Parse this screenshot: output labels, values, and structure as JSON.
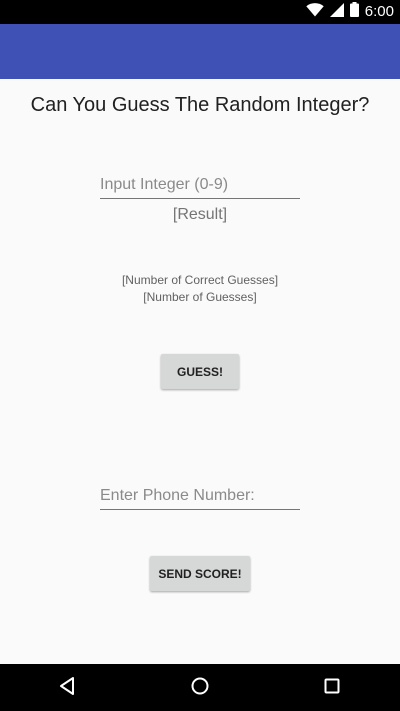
{
  "status_bar": {
    "time": "6:00",
    "icons": [
      "wifi-icon",
      "signal-icon",
      "battery-icon"
    ]
  },
  "colors": {
    "app_bar": "#3f51b5",
    "status_bar": "#000000",
    "background": "#fafafa",
    "button": "#d6d7d7"
  },
  "main": {
    "title": "Can You Guess The Random Integer?",
    "guess_input": {
      "value": "",
      "placeholder": "Input Integer (0-9)"
    },
    "result": "[Result]",
    "correct_guesses": "[Number of Correct Guesses]",
    "total_guesses": "[Number of Guesses]",
    "guess_button": "GUESS!",
    "phone_input": {
      "value": "",
      "placeholder": "Enter Phone Number:"
    },
    "send_button": "SEND SCORE!"
  },
  "nav_bar": {
    "icons": [
      "back-icon",
      "home-icon",
      "recents-icon"
    ]
  }
}
